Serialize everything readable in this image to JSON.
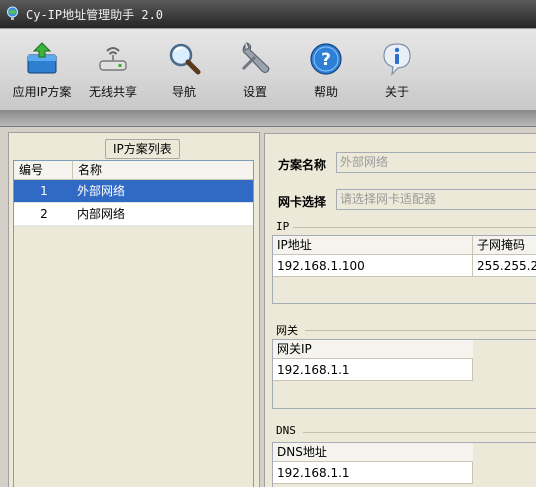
{
  "window": {
    "title": "Cy-IP地址管理助手 2.0"
  },
  "toolbar": {
    "items": [
      {
        "label": "应用IP方案",
        "icon": "apply-package-icon"
      },
      {
        "label": "无线共享",
        "icon": "wireless-share-icon"
      },
      {
        "label": "导航",
        "icon": "magnifier-icon"
      },
      {
        "label": "设置",
        "icon": "wrench-icon"
      },
      {
        "label": "帮助",
        "icon": "help-icon"
      },
      {
        "label": "关于",
        "icon": "info-icon"
      }
    ]
  },
  "left_panel": {
    "group_title": "IP方案列表",
    "columns": [
      "编号",
      "名称"
    ],
    "rows": [
      {
        "id": "1",
        "name": "外部网络",
        "selected": true
      },
      {
        "id": "2",
        "name": "内部网络",
        "selected": false
      }
    ]
  },
  "right_panel": {
    "plan_name_label": "方案名称",
    "plan_name_value": "外部网络",
    "nic_label": "网卡选择",
    "nic_placeholder": "请选择网卡适配器",
    "ip_section": {
      "title": "IP",
      "columns": [
        "IP地址",
        "子网掩码"
      ],
      "values": [
        "192.168.1.100",
        "255.255.2"
      ]
    },
    "gateway_section": {
      "title": "网关",
      "column": "网关IP",
      "value": "192.168.1.1"
    },
    "dns_section": {
      "title": "DNS",
      "column": "DNS地址",
      "value": "192.168.1.1"
    }
  },
  "colors": {
    "selection": "#316ac5",
    "panel": "#ece9d8",
    "titlebar": "#262626"
  }
}
